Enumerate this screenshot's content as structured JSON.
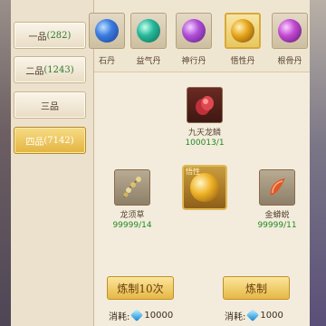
{
  "grades": [
    {
      "name": "一品",
      "count": "(282)",
      "active": false
    },
    {
      "name": "二品",
      "count": "(1243)",
      "active": false
    },
    {
      "name": "三品",
      "count": "",
      "active": false
    },
    {
      "name": "四品",
      "count": "(7142)",
      "active": true
    }
  ],
  "dans": [
    {
      "label": "石丹",
      "color": "#2a63c9"
    },
    {
      "label": "益气丹",
      "color": "#19a58a"
    },
    {
      "label": "神行丹",
      "color": "#a53ac9"
    },
    {
      "label": "悟性丹",
      "color": "#d99a18",
      "selected": true
    },
    {
      "label": "根骨丹",
      "color": "#b23fbf"
    }
  ],
  "ingredient_top": {
    "name": "九天龙鳞",
    "count": "100013/1",
    "icon": "dragon-scale-icon"
  },
  "ingredient_left": {
    "name": "龙须草",
    "count": "99999/14",
    "icon": "dragon-whisker-grass-icon"
  },
  "ingredient_right": {
    "name": "金蟒蜕",
    "count": "99999/11",
    "icon": "python-slough-icon"
  },
  "result": {
    "tag": "悟性",
    "icon": "enlightenment-pill-icon"
  },
  "buttons": {
    "craft_ten": "炼制10次",
    "craft_one": "炼制"
  },
  "costs": {
    "label": "消耗:",
    "ten_value": "10000",
    "one_value": "1000"
  },
  "colors": {
    "tab_active": "#e3b441",
    "count_green": "#1f8a1f",
    "button_gold": "#e6b845"
  }
}
